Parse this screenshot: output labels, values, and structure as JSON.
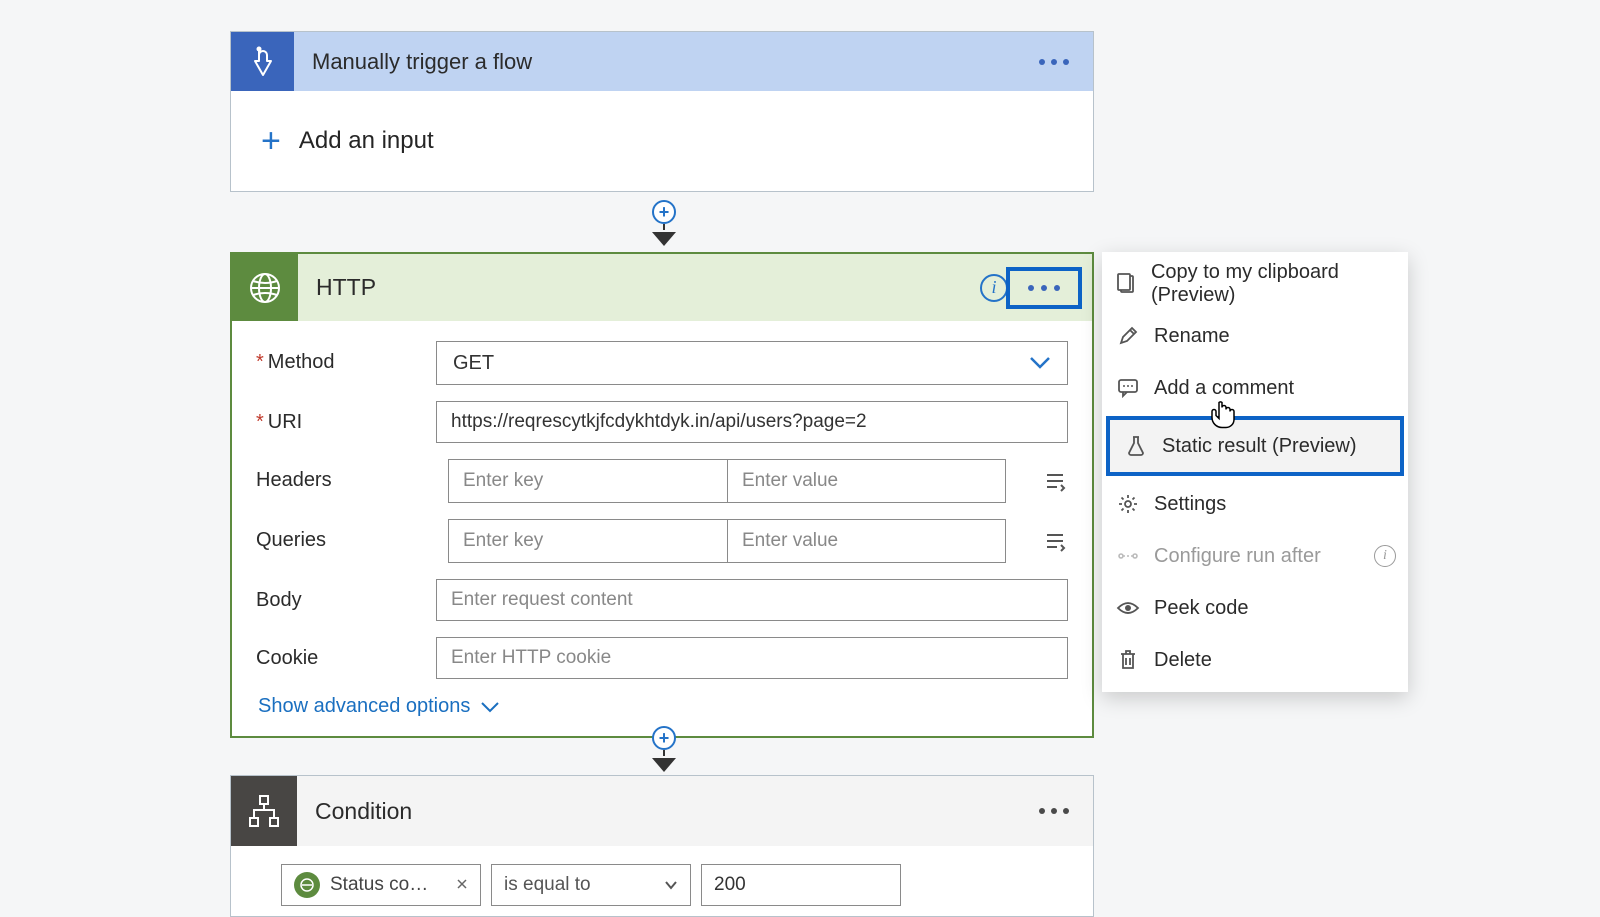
{
  "trigger": {
    "title": "Manually trigger a flow",
    "add_input": "Add an input"
  },
  "http": {
    "title": "HTTP",
    "labels": {
      "method": "Method",
      "uri": "URI",
      "headers": "Headers",
      "queries": "Queries",
      "body": "Body",
      "cookie": "Cookie"
    },
    "method_value": "GET",
    "uri_value": "https://reqrescytkjfcdykhtdyk.in/api/users?page=2",
    "placeholders": {
      "key": "Enter key",
      "value": "Enter value",
      "body": "Enter request content",
      "cookie": "Enter HTTP cookie"
    },
    "advanced": "Show advanced options"
  },
  "condition": {
    "title": "Condition",
    "status_label": "Status co…",
    "operator": "is equal to",
    "value": "200"
  },
  "menu": {
    "copy": "Copy to my clipboard (Preview)",
    "rename": "Rename",
    "comment": "Add a comment",
    "static": "Static result (Preview)",
    "settings": "Settings",
    "runafter": "Configure run after",
    "peek": "Peek code",
    "delete": "Delete"
  }
}
